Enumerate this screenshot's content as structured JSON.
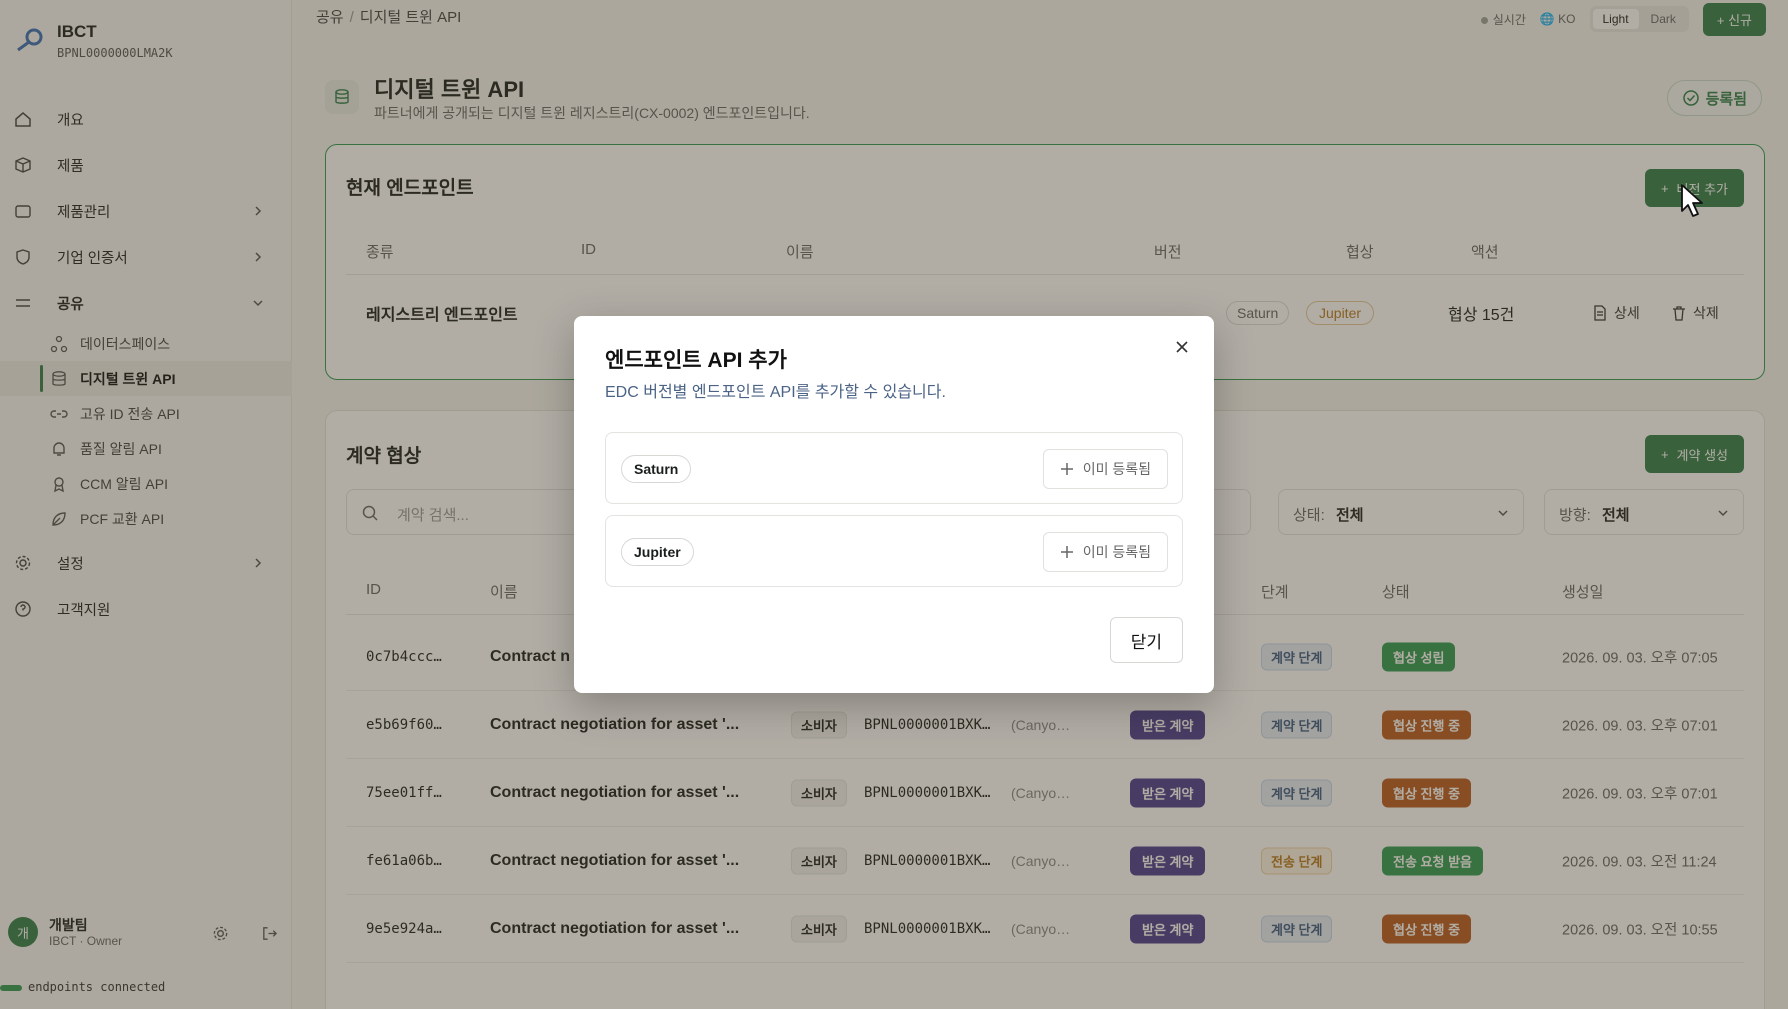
{
  "brand": {
    "name": "IBCT",
    "bpn": "BPNL0000000LMA2K"
  },
  "nav": {
    "overview": "개요",
    "products": "제품",
    "product_mgmt": "제품관리",
    "certificates": "기업 인증서",
    "sharing": "공유",
    "sharing_items": [
      "데이터스페이스",
      "디지털 트윈 API",
      "고유 ID 전송 API",
      "품질 알림 API",
      "CCM 알림 API",
      "PCF 교환 API"
    ],
    "settings": "설정",
    "support": "고객지원"
  },
  "user": {
    "avatar": "개",
    "name": "개발팀",
    "role": "IBCT · Owner"
  },
  "status": "endpoints connected",
  "topbar": {
    "crumb_parent": "공유",
    "crumb_current": "디지털 트윈 API",
    "live": "실시간",
    "lang": "KO",
    "theme_light": "Light",
    "theme_dark": "Dark",
    "new_btn": "+ 신규"
  },
  "page": {
    "title": "디지털 트윈 API",
    "subtitle": "파트너에게 공개되는 디지털 트윈 레지스트리(CX-0002) 엔드포인트입니다.",
    "registered": "등록됨"
  },
  "endpoints": {
    "title": "현재 엔드포인트",
    "add_btn": "버전 추가",
    "columns": [
      "종류",
      "ID",
      "이름",
      "버전",
      "협상",
      "액션"
    ],
    "row": {
      "type": "레지스트리 엔드포인트",
      "versions": [
        "Saturn",
        "Jupiter"
      ],
      "negotiations": "협상 15건",
      "detail": "상세",
      "delete": "삭제"
    }
  },
  "contracts": {
    "title": "계약 협상",
    "create_btn": "계약 생성",
    "search_placeholder": "계약 검색...",
    "status_filter": {
      "key": "상태:",
      "value": "전체"
    },
    "direction_filter": {
      "key": "방향:",
      "value": "전체"
    },
    "columns": [
      "ID",
      "이름",
      "단계",
      "상태",
      "생성일"
    ],
    "rows": [
      {
        "id": "0c7b4ccc…",
        "name": "Contract n",
        "role": "",
        "bpn": "",
        "partner": "",
        "dir": "",
        "step": "계약 단계",
        "status": "협상 성립",
        "date": "2026. 09. 03. 오후 07:05"
      },
      {
        "id": "e5b69f60…",
        "name": "Contract negotiation for asset '...",
        "role": "소비자",
        "bpn": "BPNL0000001BXK…",
        "partner": "(Canyo…",
        "dir": "받은 계약",
        "step": "계약 단계",
        "status": "협상 진행 중",
        "date": "2026. 09. 03. 오후 07:01"
      },
      {
        "id": "75ee01ff…",
        "name": "Contract negotiation for asset '...",
        "role": "소비자",
        "bpn": "BPNL0000001BXK…",
        "partner": "(Canyo…",
        "dir": "받은 계약",
        "step": "계약 단계",
        "status": "협상 진행 중",
        "date": "2026. 09. 03. 오후 07:01"
      },
      {
        "id": "fe61a06b…",
        "name": "Contract negotiation for asset '...",
        "role": "소비자",
        "bpn": "BPNL0000001BXK…",
        "partner": "(Canyo…",
        "dir": "받은 계약",
        "step": "전송 단계",
        "status": "전송 요청 받음",
        "date": "2026. 09. 03. 오전 11:24"
      },
      {
        "id": "9e5e924a…",
        "name": "Contract negotiation for asset '...",
        "role": "소비자",
        "bpn": "BPNL0000001BXK…",
        "partner": "(Canyo…",
        "dir": "받은 계약",
        "step": "계약 단계",
        "status": "협상 진행 중",
        "date": "2026. 09. 03. 오전 10:55"
      }
    ]
  },
  "modal": {
    "title": "엔드포인트 API 추가",
    "subtitle": "EDC 버전별 엔드포인트 API를 추가할 수 있습니다.",
    "versions": [
      {
        "name": "Saturn",
        "action": "이미 등록됨"
      },
      {
        "name": "Jupiter",
        "action": "이미 등록됨"
      }
    ],
    "close_btn": "닫기"
  },
  "colors": {
    "accent": "#2f7d4a",
    "status_green": "#2f9a52",
    "status_orange": "#b85a1f",
    "received": "#4a3d8f",
    "overlay": "rgba(70,60,40,0.42)"
  }
}
